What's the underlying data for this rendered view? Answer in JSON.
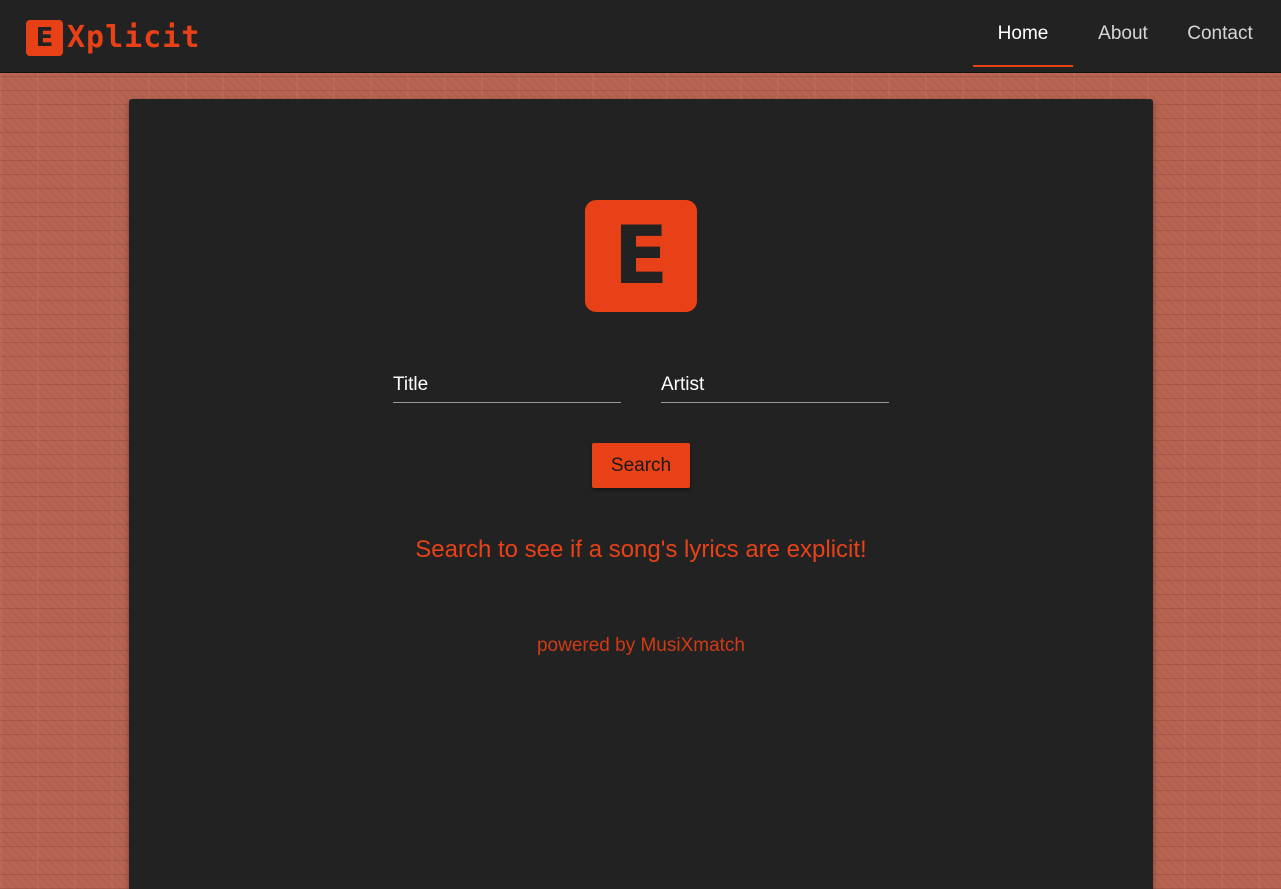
{
  "brand": {
    "letter": "E",
    "text": "Xplicit"
  },
  "nav": {
    "items": [
      {
        "label": "Home",
        "active": true
      },
      {
        "label": "About",
        "active": false
      },
      {
        "label": "Contact",
        "active": false
      }
    ]
  },
  "main": {
    "logo_letter": "E",
    "title_field": {
      "value": "",
      "placeholder": "Title"
    },
    "artist_field": {
      "value": "",
      "placeholder": "Artist"
    },
    "search_label": "Search",
    "tagline": "Search to see if a song's lyrics are explicit!",
    "powered_by": "powered by MusiXmatch"
  },
  "colors": {
    "accent": "#e84118",
    "navbar_bg": "#222222",
    "card_bg": "#222222",
    "page_bg": "#b86452"
  }
}
